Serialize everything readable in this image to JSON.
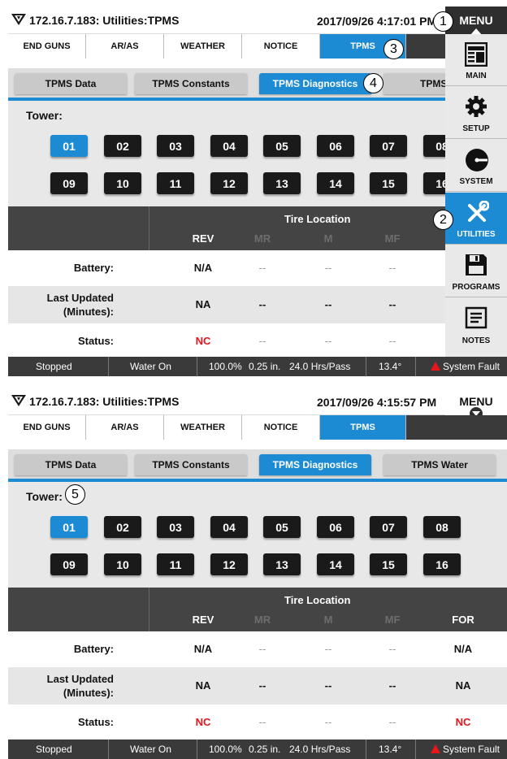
{
  "screen1": {
    "title": "172.16.7.183: Utilities:TPMS",
    "datetime": "2017/09/26 4:17:01 PM",
    "menu_label": "MENU",
    "top_tabs": [
      "END GUNS",
      "AR/AS",
      "WEATHER",
      "NOTICE",
      "TPMS"
    ],
    "sub_tabs": [
      "TPMS Data",
      "TPMS Constants",
      "TPMS Diagnostics",
      "TPMS Water"
    ],
    "sub_tab_w_partial": "TPMS W",
    "tower_label": "Tower:",
    "towers_row1": [
      "01",
      "02",
      "03",
      "04",
      "05",
      "06",
      "07",
      "08"
    ],
    "towers_row2": [
      "09",
      "10",
      "11",
      "12",
      "13",
      "14",
      "15",
      "16"
    ],
    "tire_location": "Tire Location",
    "columns": [
      "REV",
      "MR",
      "M",
      "MF"
    ],
    "rows": [
      {
        "label": "Battery:",
        "values": [
          "N/A",
          "--",
          "--",
          "--"
        ]
      },
      {
        "label": "Last Updated\n(Minutes):",
        "values": [
          "NA",
          "--",
          "--",
          "--"
        ]
      },
      {
        "label": "Status:",
        "values": [
          "NC",
          "--",
          "--",
          "--"
        ]
      }
    ],
    "status_bar": {
      "state": "Stopped",
      "water": "Water On",
      "percent": "100.0%",
      "depth": "0.25 in.",
      "hours": "24.0 Hrs/Pass",
      "angle": "13.4°",
      "fault": "System Fault"
    },
    "side_menu": [
      "MAIN",
      "SETUP",
      "SYSTEM",
      "UTILITIES",
      "PROGRAMS",
      "NOTES"
    ]
  },
  "screen2": {
    "title": "172.16.7.183: Utilities:TPMS",
    "datetime": "2017/09/26 4:15:57 PM",
    "menu_label": "MENU",
    "top_tabs": [
      "END GUNS",
      "AR/AS",
      "WEATHER",
      "NOTICE",
      "TPMS"
    ],
    "sub_tabs": [
      "TPMS Data",
      "TPMS Constants",
      "TPMS Diagnostics",
      "TPMS Water"
    ],
    "tower_label": "Tower:",
    "towers_row1": [
      "01",
      "02",
      "03",
      "04",
      "05",
      "06",
      "07",
      "08"
    ],
    "towers_row2": [
      "09",
      "10",
      "11",
      "12",
      "13",
      "14",
      "15",
      "16"
    ],
    "tire_location": "Tire Location",
    "columns": [
      "REV",
      "MR",
      "M",
      "MF",
      "FOR"
    ],
    "rows": [
      {
        "label": "Battery:",
        "values": [
          "N/A",
          "--",
          "--",
          "--",
          "N/A"
        ]
      },
      {
        "label": "Last Updated\n(Minutes):",
        "values": [
          "NA",
          "--",
          "--",
          "--",
          "NA"
        ]
      },
      {
        "label": "Status:",
        "values": [
          "NC",
          "--",
          "--",
          "--",
          "NC"
        ]
      }
    ],
    "status_bar": {
      "state": "Stopped",
      "water": "Water On",
      "percent": "100.0%",
      "depth": "0.25 in.",
      "hours": "24.0 Hrs/Pass",
      "angle": "13.4°",
      "fault": "System Fault"
    }
  },
  "callouts": [
    "1",
    "2",
    "3",
    "4",
    "5"
  ],
  "colors": {
    "accent": "#1d8bd3",
    "dark": "#1a1a1a",
    "header": "#444444",
    "fault": "#e8151b"
  }
}
